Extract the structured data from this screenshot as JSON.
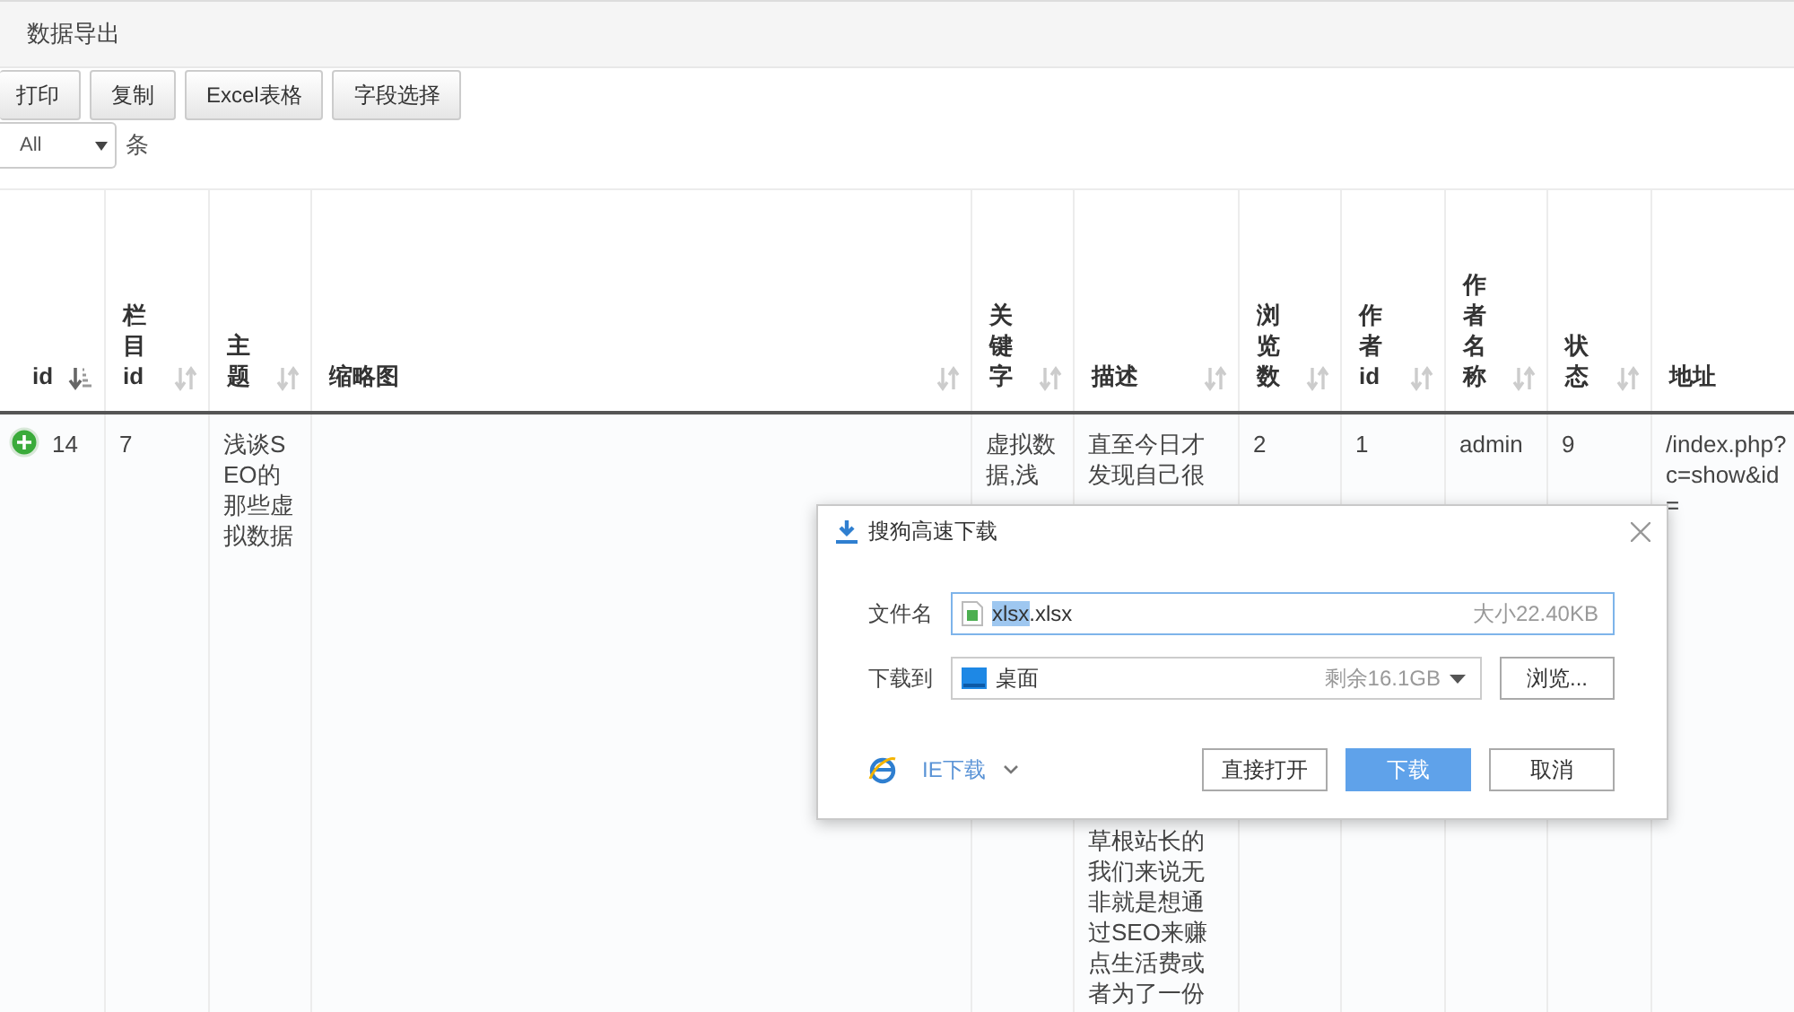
{
  "page_title": "数据导出",
  "toolbar": [
    "打印",
    "复制",
    "Excel表格",
    "字段选择"
  ],
  "page_size": {
    "value": "All",
    "suffix": "条"
  },
  "table": {
    "columns": [
      {
        "label": "id",
        "narrow": true,
        "kind": "sortable",
        "sorted": true
      },
      {
        "label": "栏目id",
        "narrow": true,
        "kind": "sortable",
        "sorted": false
      },
      {
        "label": "主题",
        "narrow": true,
        "kind": "sortable",
        "sorted": false
      },
      {
        "label": "缩略图",
        "narrow": false,
        "kind": "sortable",
        "sorted": false
      },
      {
        "label": "关键字",
        "narrow": true,
        "kind": "sortable",
        "sorted": false
      },
      {
        "label": "描述",
        "narrow": false,
        "kind": "sortable",
        "sorted": false
      },
      {
        "label": "浏览数",
        "narrow": true,
        "kind": "sortable",
        "sorted": false
      },
      {
        "label": "作者id",
        "narrow": true,
        "kind": "sortable",
        "sorted": false
      },
      {
        "label": "作者名称",
        "narrow": true,
        "kind": "sortable",
        "sorted": false
      },
      {
        "label": "状态",
        "narrow": true,
        "kind": "sortable",
        "sorted": false
      },
      {
        "label": "地址",
        "narrow": false,
        "kind": "plain"
      }
    ],
    "rows": [
      {
        "expandable": true,
        "cells": [
          {
            "kind": "text",
            "text": "14"
          },
          {
            "kind": "text",
            "text": "7"
          },
          {
            "kind": "text",
            "text": "浅谈SEO的那些虚拟数据"
          },
          {
            "kind": "empty"
          },
          {
            "kind": "text",
            "text": "虚拟数据,浅"
          },
          {
            "kind": "split",
            "above": "直至今日才发现自己很",
            "below": "草根站长的我们来说无非就是想通过SEO来赚点生活费或者为了一份"
          },
          {
            "kind": "text",
            "text": "2"
          },
          {
            "kind": "text",
            "text": "1"
          },
          {
            "kind": "text",
            "text": "admin"
          },
          {
            "kind": "text",
            "text": "9"
          },
          {
            "kind": "text",
            "text": "/index.php?c=show&id="
          }
        ]
      }
    ]
  },
  "dialog": {
    "title": "搜狗高速下载",
    "file_label": "文件名",
    "file_name": {
      "selected_text": "xlsx",
      "rest_text": ".xlsx",
      "size": "大小22.40KB"
    },
    "target_label": "下载到",
    "target": {
      "value": "桌面",
      "free": "剩余16.1GB"
    },
    "browse": "浏览...",
    "ie_link": "IE下载",
    "buttons": [
      {
        "label": "直接打开",
        "primary": false
      },
      {
        "label": "下载",
        "primary": true
      },
      {
        "label": "取消",
        "primary": false
      }
    ]
  }
}
